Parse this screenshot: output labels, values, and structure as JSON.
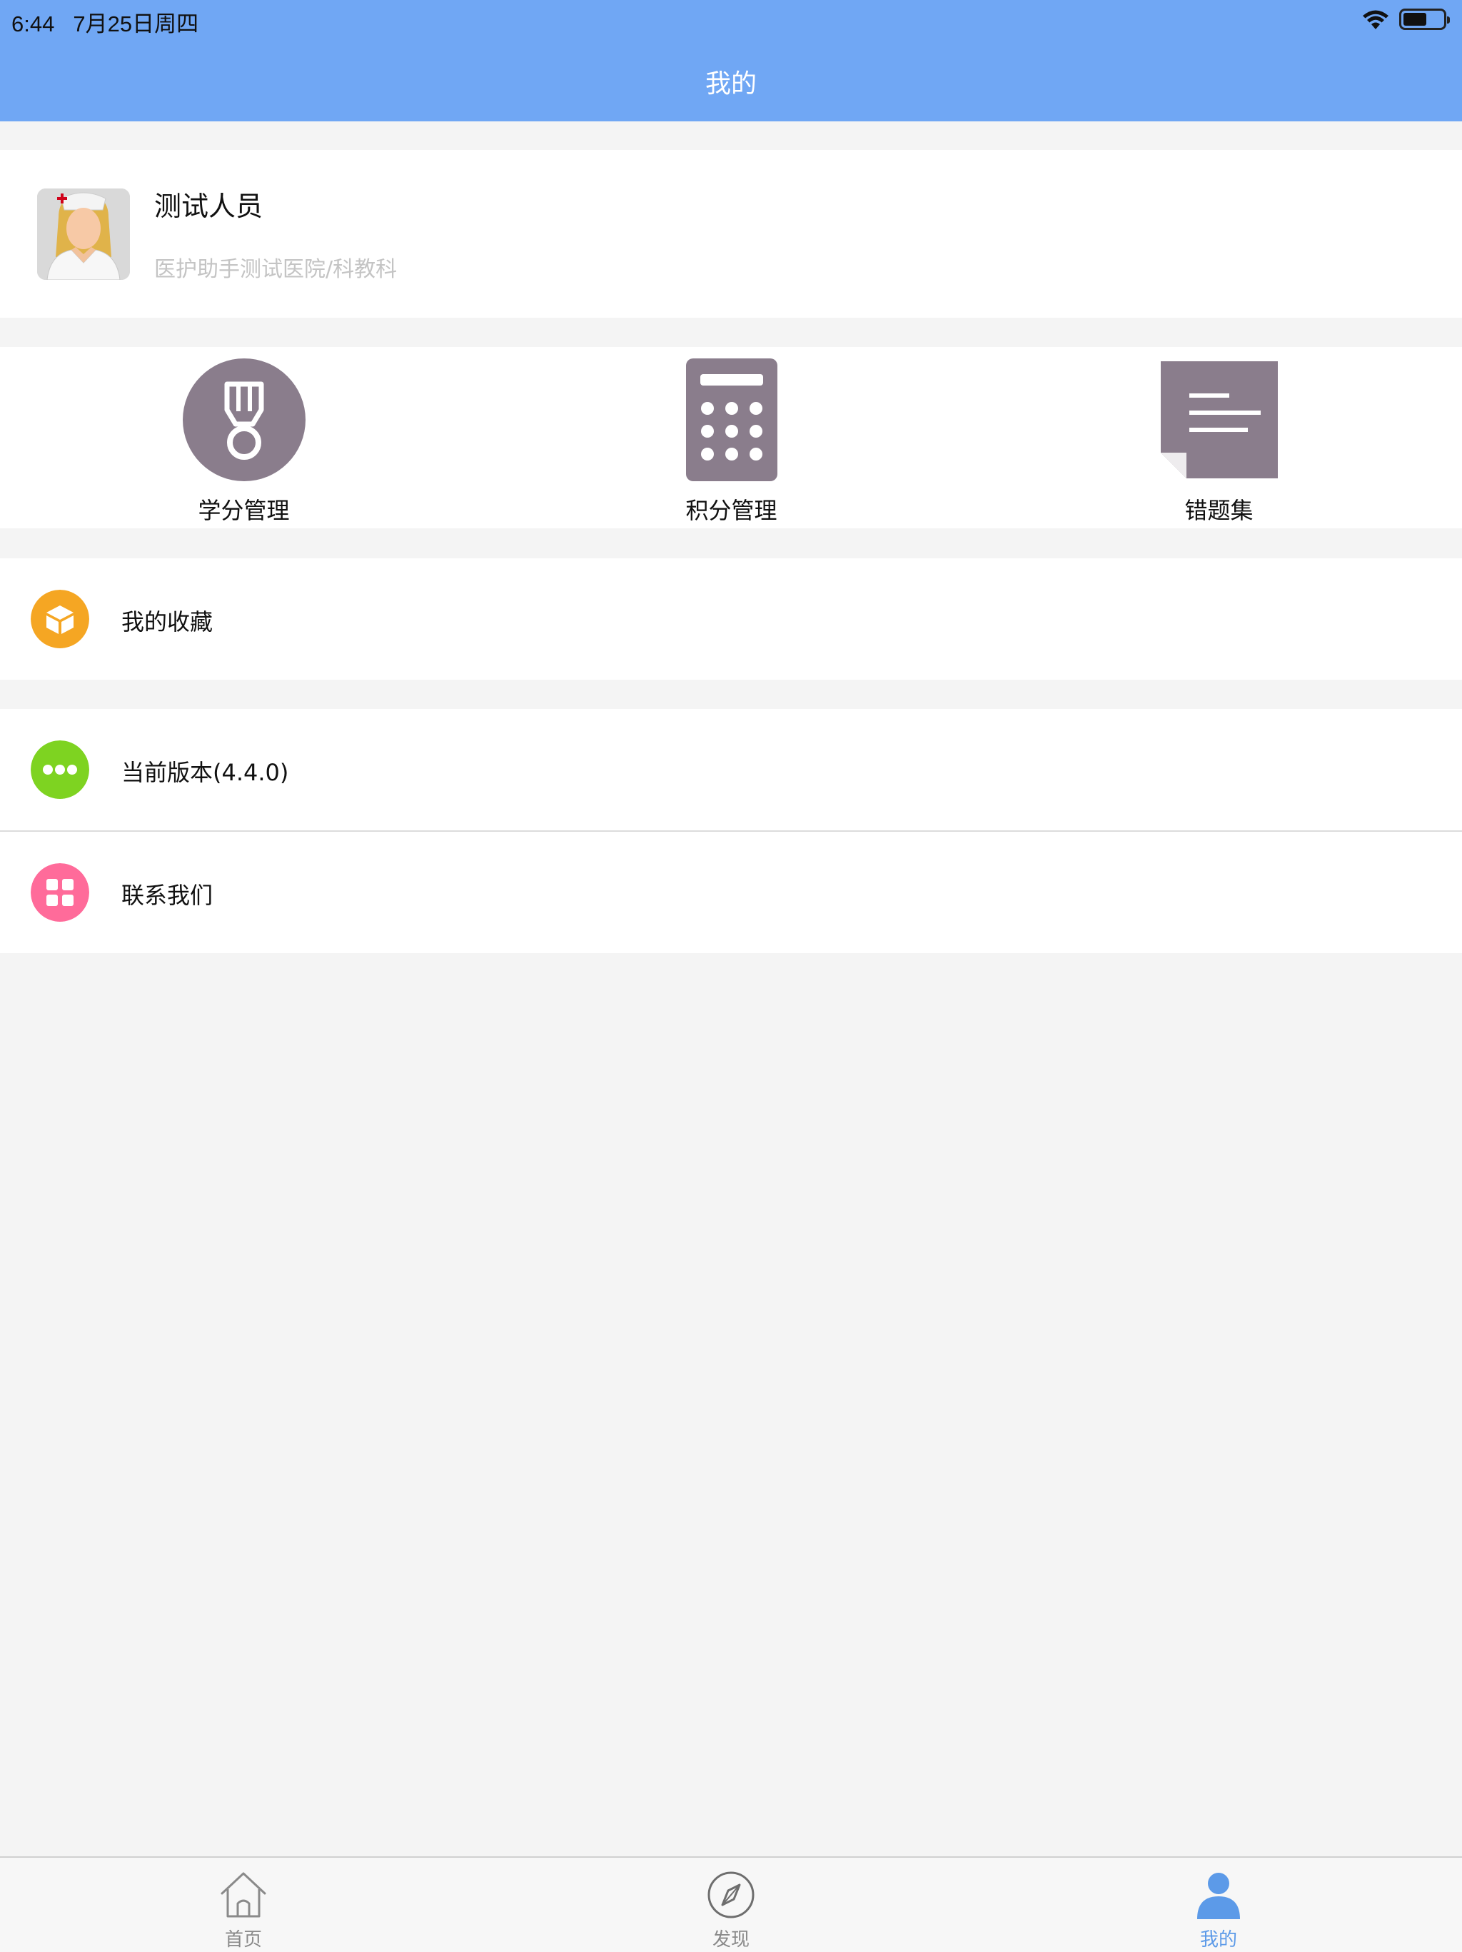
{
  "status_bar": {
    "time": "6:44",
    "date": "7月25日周四",
    "battery_level": 0.6
  },
  "header": {
    "title": "我的"
  },
  "profile": {
    "name": "测试人员",
    "organization": "医护助手测试医院/科教科"
  },
  "quick_actions": [
    {
      "label": "学分管理",
      "icon": "medal-icon"
    },
    {
      "label": "积分管理",
      "icon": "calculator-icon"
    },
    {
      "label": "错题集",
      "icon": "document-icon"
    }
  ],
  "menu": {
    "favorites": {
      "label": "我的收藏",
      "icon": "box-icon",
      "color": "#f5a623"
    },
    "version": {
      "label": "当前版本(4.4.0)",
      "icon": "more-dots-icon",
      "color": "#7ed321"
    },
    "contact": {
      "label": "联系我们",
      "icon": "grid-icon",
      "color": "#ff6b9a"
    }
  },
  "tab_bar": {
    "tabs": [
      {
        "label": "首页",
        "icon": "home-icon",
        "active": false
      },
      {
        "label": "发现",
        "icon": "compass-icon",
        "active": false
      },
      {
        "label": "我的",
        "icon": "person-icon",
        "active": true
      }
    ],
    "active_color": "#5c9ae8"
  },
  "colors": {
    "header": "#70a7f4",
    "icon_gray": "#8a7d8c"
  }
}
